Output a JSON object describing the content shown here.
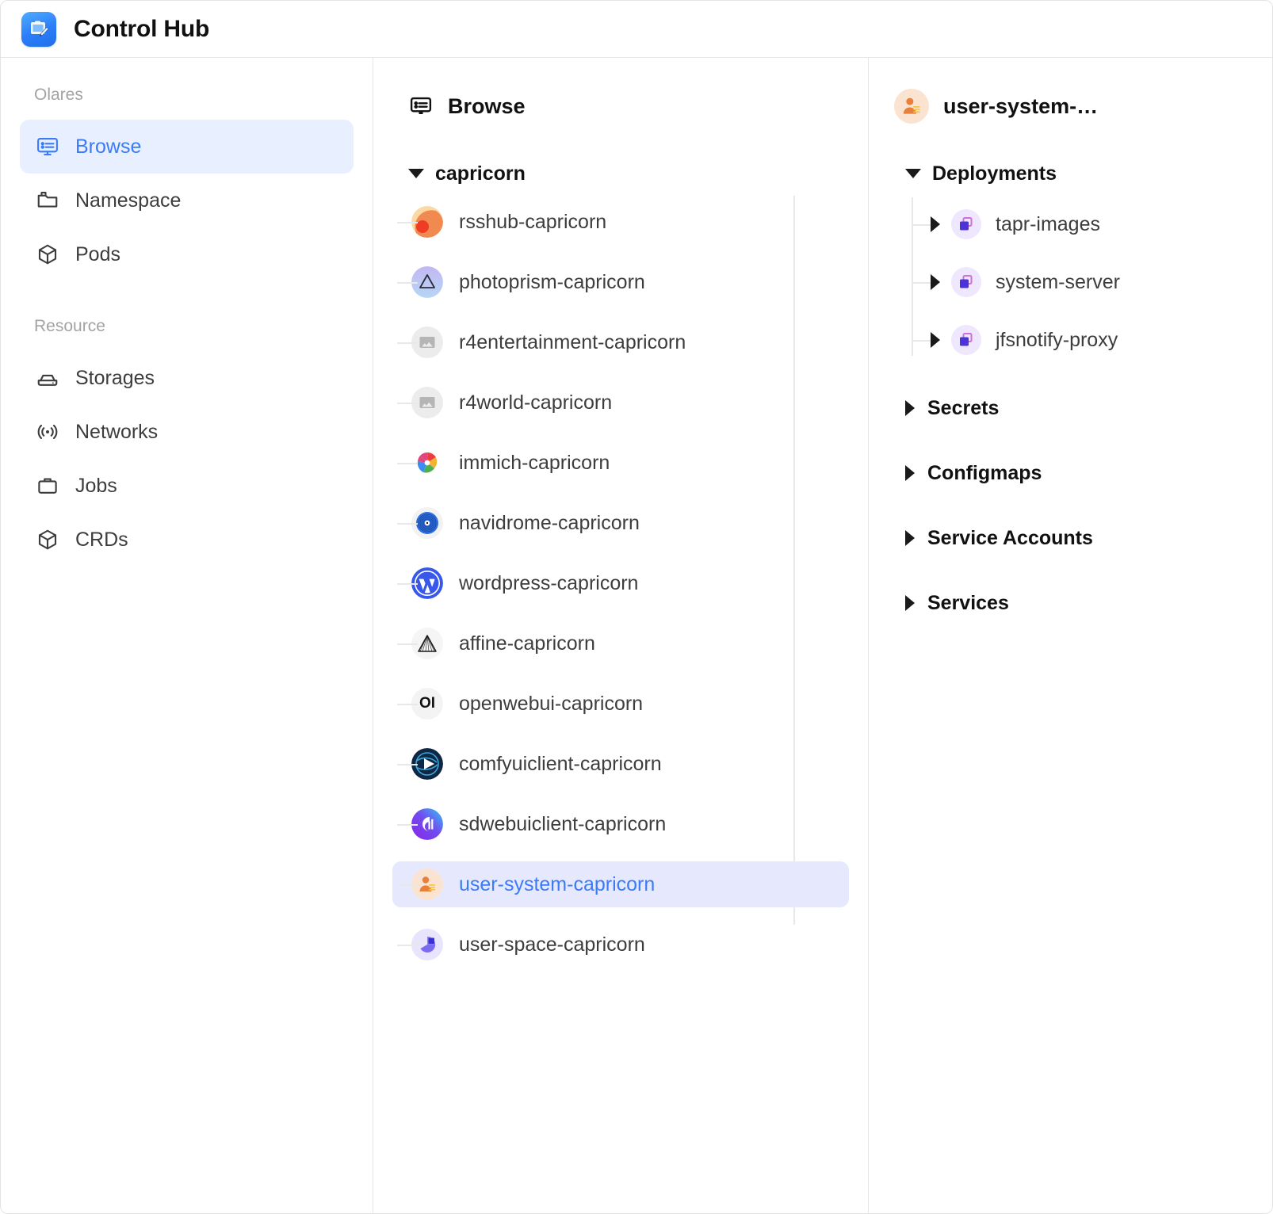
{
  "window": {
    "title": "Control Hub",
    "app_icon": "control-hub-app-icon"
  },
  "sidebar": {
    "groups": [
      {
        "label": "Olares",
        "items": [
          {
            "label": "Browse",
            "icon": "browse-screen-icon",
            "active": true
          },
          {
            "label": "Namespace",
            "icon": "namespace-folder-icon",
            "active": false
          },
          {
            "label": "Pods",
            "icon": "pods-cube-icon",
            "active": false
          }
        ]
      },
      {
        "label": "Resource",
        "items": [
          {
            "label": "Storages",
            "icon": "storage-drive-icon",
            "active": false
          },
          {
            "label": "Networks",
            "icon": "network-signal-icon",
            "active": false
          },
          {
            "label": "Jobs",
            "icon": "jobs-briefcase-icon",
            "active": false
          },
          {
            "label": "CRDs",
            "icon": "crds-cube-icon",
            "active": false
          }
        ]
      }
    ]
  },
  "middle": {
    "header": {
      "title": "Browse",
      "icon": "browse-screen-icon"
    },
    "tree": {
      "root": {
        "label": "capricorn",
        "expanded": true
      },
      "items": [
        {
          "label": "rsshub-capricorn",
          "icon": "rsshub-icon",
          "selected": false
        },
        {
          "label": "photoprism-capricorn",
          "icon": "photoprism-icon",
          "selected": false
        },
        {
          "label": "r4entertainment-capricorn",
          "icon": "image-placeholder-icon",
          "selected": false
        },
        {
          "label": "r4world-capricorn",
          "icon": "image-placeholder-icon",
          "selected": false
        },
        {
          "label": "immich-capricorn",
          "icon": "immich-icon",
          "selected": false
        },
        {
          "label": "navidrome-capricorn",
          "icon": "navidrome-icon",
          "selected": false
        },
        {
          "label": "wordpress-capricorn",
          "icon": "wordpress-icon",
          "selected": false
        },
        {
          "label": "affine-capricorn",
          "icon": "affine-icon",
          "selected": false
        },
        {
          "label": "openwebui-capricorn",
          "icon": "openwebui-icon",
          "selected": false
        },
        {
          "label": "comfyuiclient-capricorn",
          "icon": "comfyui-icon",
          "selected": false
        },
        {
          "label": "sdwebuiclient-capricorn",
          "icon": "sdwebui-icon",
          "selected": false
        },
        {
          "label": "user-system-capricorn",
          "icon": "user-system-icon",
          "selected": true
        },
        {
          "label": "user-space-capricorn",
          "icon": "user-space-icon",
          "selected": false
        }
      ]
    }
  },
  "right": {
    "header": {
      "title": "user-system-…",
      "icon": "user-system-icon"
    },
    "groups": [
      {
        "label": "Deployments",
        "expanded": true,
        "items": [
          {
            "label": "tapr-images",
            "icon": "deployment-icon",
            "expanded": false
          },
          {
            "label": "system-server",
            "icon": "deployment-icon",
            "expanded": false
          },
          {
            "label": "jfsnotify-proxy",
            "icon": "deployment-icon",
            "expanded": false
          }
        ]
      },
      {
        "label": "Secrets",
        "expanded": false,
        "items": []
      },
      {
        "label": "Configmaps",
        "expanded": false,
        "items": []
      },
      {
        "label": "Service Accounts",
        "expanded": false,
        "items": []
      },
      {
        "label": "Services",
        "expanded": false,
        "items": []
      }
    ]
  },
  "colors": {
    "accent": "#3b7bf6",
    "sidebar_active_bg": "#e8efff",
    "row_selected_bg": "#e6e9fd",
    "divider": "#e6e6e6",
    "tree_line": "#e8e8e8",
    "muted_text": "#a3a3a3",
    "body_text": "#3d3d3d"
  }
}
